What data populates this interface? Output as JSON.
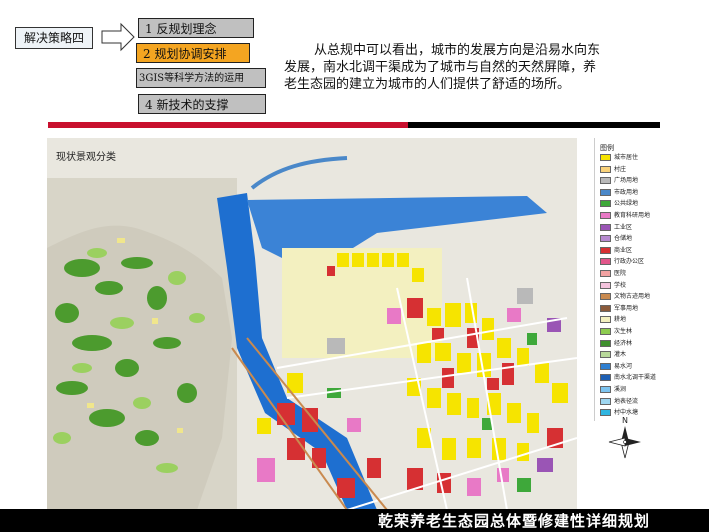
{
  "header": {
    "strategy_label": "解决策略四",
    "steps": [
      {
        "label": "1  反规划理念"
      },
      {
        "label": "2  规划协调安排"
      },
      {
        "label": "3GIS等科学方法的运用"
      },
      {
        "label": "4  新技术的支撑"
      }
    ]
  },
  "description": {
    "line1": "从总规中可以看出，城市的发展方向是沿易水向东",
    "line2": "发展，南水北调干渠成为了城市与自然的天然屏障，养",
    "line3": "老生态园的建立为城市的人们提供了舒适的场所。"
  },
  "map": {
    "title": "现状景观分类",
    "legend_title": "图例",
    "legend": [
      {
        "label": "城市居住",
        "color": "#f6e400"
      },
      {
        "label": "村庄",
        "color": "#f9d27a"
      },
      {
        "label": "广场用地",
        "color": "#b9b9b9"
      },
      {
        "label": "市政用地",
        "color": "#4a88c9"
      },
      {
        "label": "公共绿地",
        "color": "#3ea83a"
      },
      {
        "label": "教育科研用地",
        "color": "#e879c6"
      },
      {
        "label": "工业区",
        "color": "#9a55b5"
      },
      {
        "label": "仓储地",
        "color": "#b68ad0"
      },
      {
        "label": "商业区",
        "color": "#d63033"
      },
      {
        "label": "行政办公区",
        "color": "#e2568a"
      },
      {
        "label": "医院",
        "color": "#f2a2a2"
      },
      {
        "label": "学校",
        "color": "#f4c3dd"
      },
      {
        "label": "文物古迹用地",
        "color": "#c98a4f"
      },
      {
        "label": "军事用地",
        "color": "#8a5a3b"
      },
      {
        "label": "耕地",
        "color": "#f3f0c0"
      },
      {
        "label": "次生林",
        "color": "#8dcc50"
      },
      {
        "label": "经济林",
        "color": "#3f8f2e"
      },
      {
        "label": "灌木",
        "color": "#b9d99b"
      },
      {
        "label": "易水河",
        "color": "#2f7fd1"
      },
      {
        "label": "南水北调干渠道",
        "color": "#1e5fb3"
      },
      {
        "label": "溪涧",
        "color": "#7dc4ef"
      },
      {
        "label": "地表径流",
        "color": "#9ed6f0"
      },
      {
        "label": "村中水塘",
        "color": "#2fb5e0"
      }
    ]
  },
  "footer": {
    "title": "乾荣养老生态园总体暨修建性详细规划"
  }
}
